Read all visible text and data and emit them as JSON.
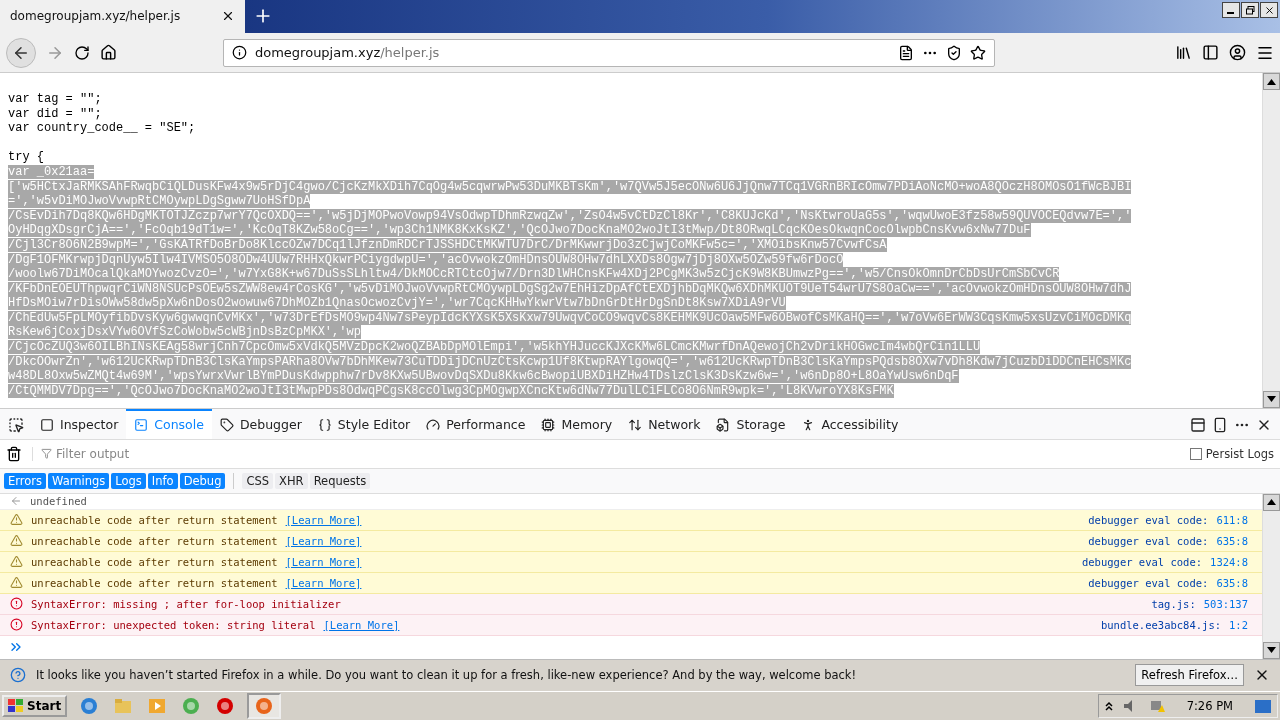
{
  "browser_tab": {
    "title": "domegroupjam.xyz/helper.js",
    "selected": true
  },
  "address_bar": {
    "domain": "domegroupjam.xyz",
    "path": "/helper.js"
  },
  "source_paragraphs": [
    [
      "var tag = \"\";",
      "var did = \"\";",
      "var country_code__ = \"SE\";"
    ],
    [
      "try {"
    ]
  ],
  "source_lines": [
    {
      "text": "var _0x21aa=",
      "selected": true
    },
    {
      "text": "['w5HCtxJaRMKSAhFRwqbCiQLDusKFw4x9w5rDjC4gwo/CjcKzMkXDih7CqOg4w5cqwrwPw53DuMKBTsKm','w7QVw5J5ecONw6U6JjQnw7TCq1VGRnBRIcOmw7PDiAoNcMO+woA8QOczH8OMOsO1fWcBJBI",
      "selected": true
    },
    {
      "text": "=','w5vDiMOJwoVvwpRtCMOywpLDgSgww7UoHSfDpA",
      "selected": true
    },
    {
      "text": "/CsEvDih7Dq8KQw6HDgMKTOTJZczp7wrY7QcOXDQ==','w5jDjMOPwoVowp94VsOdwpTDhmRzwqZw','ZsO4w5vCtDzCl8Kr','C8KUJcKd','NsKtwroUaG5s','wqwUwoE3fz58w59QUVOCEQdvw7E=','",
      "selected": true
    },
    {
      "text": "OyHDqgXDsgrCjA==','FcOqb19dT1w=','KcOqT8KZw58oCg==','wp3Ch1NMK8KxKsKZ','QcOJwo7DocKnaMO2woJtI3tMwp/Dt8ORwqLCqcKOesOkwqnCocOlwpbCnsKvw6xNw77DuF",
      "selected": true
    },
    {
      "text": "/Cjl3Cr8O6N2B9wpM=','GsKATRfDoBrDo8KlccOZw7DCq1lJfznDmRDCrTJSSHDCtMKWTU7DrC/DrMKwwrjDo3zCjwjCoMKFw5c=','XMOibsKnw57CvwfCsA",
      "selected": true
    },
    {
      "text": "/DgF1OFMKrwpjDqnUyw5Ilw4IVMSO5O8ODw4UUw7RHHxQkwrPCiygdwpU=','acOvwokzOmHDnsOUW8OHw7dhLXXDs8Ogw7jDj8OXw5OZw59fw6rDocO",
      "selected": true
    },
    {
      "text": "/woolw67DiMOcalQkaMOYwozCvzO=','w7YxG8K+w67DuSsSLhltw4/DkMOCcRTCtcOjw7/Drn3DlWHCnsKFw4XDj2PCgMK3w5zCjcK9W8KBUmwzPg==','w5/CnsOkOmnDrCbDsUrCmSbCvCR",
      "selected": true
    },
    {
      "text": "/KFbDnEOEUThpwqrCiWN8NSUcPsOEw5sZWW8ew4rCosKG','w5vDiMOJwoVvwpRtCMOywpLDgSg2w7EhHizDpAfCtEXDjhbDqMKQw6XDhMKUOT9UeT54wrU7S8OaCw==','acOvwokzOmHDnsOUW8OHw7dhJ",
      "selected": true
    },
    {
      "text": "HfDsMOiw7rDisOWw58dw5pXw6nDosO2wowuw67DhMOZb1QnasOcwozCvjY=','wr7CqcKHHwYkwrVtw7bDnGrDtHrDgSnDt8Ksw7XDiA9rVU",
      "selected": true
    },
    {
      "text": "/ChEdUw5FpLMOyfibDvsKyw6gwwqnCvMKx','w73DrEfDsMO9wp4Nw7sPeypIdcKYXsK5XsKxw79UwqvCoCO9wqvCs8KEHMK9UcOaw5MFw6OBwofCsMKaHQ==','w7oVw6ErWW3CqsKmw5xsUzvCiMOcDMKq",
      "selected": true
    },
    {
      "text": "RsKew6jCoxjDsxVYw6OVfSzCoWobw5cWBjnDsBzCpMKX','wp",
      "selected": true
    },
    {
      "text": "/CjcOcZUQ3w6OILBhINsKEAg58wrjCnh7CpcOmw5xVdkQ5MVzDpcK2woQZBAbDpMOlEmpi','w5khYHJuccKJXcKMw6LCmcKMwrfDnAQewojCh2vDrikHOGwcIm4wbQrCin1LLU",
      "selected": true
    },
    {
      "text": "/DkcOOwrZn','w612UcKRwpTDnB3ClsKaYmpsPARha8OVw7bDhMKew73CuTDDijDCnUzCtsKcwp1Uf8KtwpRAYlgowqQ=','w612UcKRwpTDnB3ClsKaYmpsPQdsb8OXw7vDh8Kdw7jCuzbDiDDCnEHCsMKc",
      "selected": true
    },
    {
      "text": "w48DL8Oxw5wZMQt4w69M','wpsYwrxVwrlBYmPDusKdwpphw7rDv8KXw5UBwovDqSXDu8Kkw6cBwopiUBXDiHZHw4TDslzClsK3DsKzw6w=','w6nDp8O+L8OaYwUsw6nDqF",
      "selected": true
    },
    {
      "text": "/CtQMMDV7Dpg==','QcOJwo7DocKnaMO2woJtI3tMwpPDs8OdwqPCgsK8ccOlwg3CpMOgwpXCncKtw6dNw77DulLCiFLCo8O6NmR9wpk=','L8KVwroYX8KsFMK",
      "selected": true
    }
  ],
  "devtools": {
    "tabs": [
      {
        "label": "Inspector",
        "selected": false
      },
      {
        "label": "Console",
        "selected": true
      },
      {
        "label": "Debugger",
        "selected": false
      },
      {
        "label": "Style Editor",
        "selected": false
      },
      {
        "label": "Performance",
        "selected": false
      },
      {
        "label": "Memory",
        "selected": false
      },
      {
        "label": "Network",
        "selected": false
      },
      {
        "label": "Storage",
        "selected": false
      },
      {
        "label": "Accessibility",
        "selected": false
      }
    ],
    "filter": {
      "placeholder": "Filter output"
    },
    "persist_logs": {
      "label": "Persist Logs",
      "checked": false
    },
    "filters": [
      {
        "label": "Errors",
        "on": true
      },
      {
        "label": "Warnings",
        "on": true
      },
      {
        "label": "Logs",
        "on": true
      },
      {
        "label": "Info",
        "on": true
      },
      {
        "label": "Debug",
        "on": true
      },
      {
        "label": "CSS",
        "on": false
      },
      {
        "label": "XHR",
        "on": false
      },
      {
        "label": "Requests",
        "on": false
      }
    ],
    "messages": [
      {
        "kind": "result",
        "text": "undefined"
      },
      {
        "kind": "warning",
        "text": "unreachable code after return statement",
        "link": "[Learn More]",
        "source": "debugger eval code:",
        "position": "611:8"
      },
      {
        "kind": "warning",
        "text": "unreachable code after return statement",
        "link": "[Learn More]",
        "source": "debugger eval code:",
        "position": "635:8"
      },
      {
        "kind": "warning",
        "text": "unreachable code after return statement",
        "link": "[Learn More]",
        "source": "debugger eval code:",
        "position": "1324:8"
      },
      {
        "kind": "warning",
        "text": "unreachable code after return statement",
        "link": "[Learn More]",
        "source": "debugger eval code:",
        "position": "635:8"
      },
      {
        "kind": "error",
        "text": "SyntaxError: missing ; after for-loop initializer",
        "source": "tag.js:",
        "position": "503:137"
      },
      {
        "kind": "error",
        "text": "SyntaxError: unexpected token: string literal",
        "link": "[Learn More]",
        "source": "bundle.ee3abc84.js:",
        "position": "1:2"
      }
    ]
  },
  "notification": {
    "text": "It looks like you haven’t started Firefox in a while. Do you want to clean it up for a fresh, like-new experience? And by the way, welcome back!",
    "button": "Refresh Firefox…"
  },
  "taskbar": {
    "start": "Start",
    "clock": "7:26 PM"
  }
}
